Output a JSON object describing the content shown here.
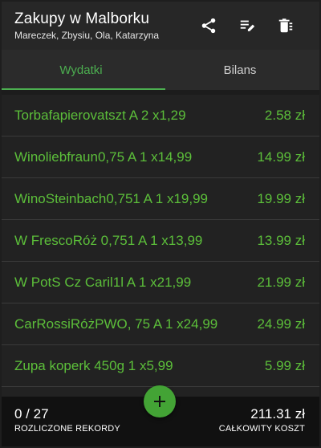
{
  "header": {
    "title": "Zakupy w Malborku",
    "subtitle": "Mareczek, Zbysiu, Ola, Katarzyna",
    "actions": [
      {
        "icon": "share-icon"
      },
      {
        "icon": "edit-list-icon"
      },
      {
        "icon": "delete-icon"
      }
    ]
  },
  "tabs": [
    {
      "label": "Wydatki",
      "active": true
    },
    {
      "label": "Bilans",
      "active": false
    }
  ],
  "expenses": [
    {
      "name": "Torbafapierovatszt A 2 x1,29",
      "amount": "2.58 zł"
    },
    {
      "name": "Winoliebfraun0,75 A 1 x14,99",
      "amount": "14.99 zł"
    },
    {
      "name": "WinoSteinbach0,751 A 1 x19,99",
      "amount": "19.99 zł"
    },
    {
      "name": "W FrescoRóż 0,751 A 1 x13,99",
      "amount": "13.99 zł"
    },
    {
      "name": "W PotS Cz Caril1l A 1 x21,99",
      "amount": "21.99 zł"
    },
    {
      "name": "CarRossiRóżPWO, 75 A 1 x24,99",
      "amount": "24.99 zł"
    },
    {
      "name": "Zupa koperk 450g 1 x5,99",
      "amount": "5.99 zł"
    },
    {
      "name": "",
      "amount": ""
    }
  ],
  "footer": {
    "settled_count": "0 / 27",
    "settled_label": "ROZLICZONE REKORDY",
    "total": "211.31 zł",
    "total_label": "CAŁKOWITY KOSZT"
  },
  "fab": {
    "icon": "plus-icon"
  },
  "colors": {
    "accent": "#4caf50",
    "item_text": "#5cbf3a",
    "fab": "#43a335",
    "background": "#222222",
    "footer": "#111111"
  }
}
